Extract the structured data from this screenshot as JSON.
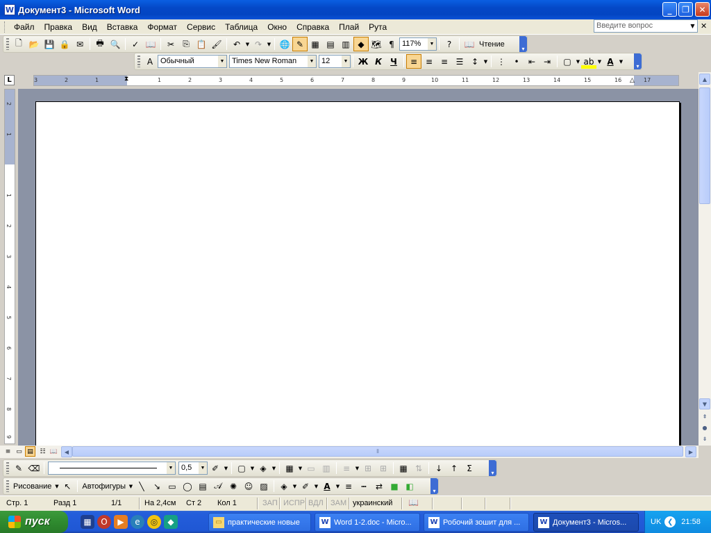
{
  "window": {
    "title": "Документ3 - Microsoft Word",
    "app_icon": "W"
  },
  "menu": {
    "items": [
      "Файл",
      "Правка",
      "Вид",
      "Вставка",
      "Формат",
      "Сервис",
      "Таблица",
      "Окно",
      "Справка",
      "Плай",
      "Рута"
    ],
    "ask_placeholder": "Введите вопрос"
  },
  "standard_toolbar": {
    "zoom": "117%",
    "read_label": "Чтение"
  },
  "formatting_toolbar": {
    "style": "Обычный",
    "font": "Times New Roman",
    "size": "12",
    "bold": "Ж",
    "italic": "К",
    "underline": "Ч"
  },
  "ruler": {
    "tab_selector": "L",
    "h_labels": [
      "3",
      "2",
      "1",
      "1",
      "2",
      "3",
      "4",
      "5",
      "6",
      "7",
      "8",
      "9",
      "10",
      "11",
      "12",
      "13",
      "14",
      "15",
      "16",
      "17"
    ],
    "v_labels": [
      "2",
      "1",
      "1",
      "2",
      "3",
      "4",
      "5",
      "6",
      "7",
      "8",
      "9"
    ]
  },
  "drawing_toolbar": {
    "drawing_label": "Рисование",
    "autoshapes_label": "Автофигуры"
  },
  "tables_toolbar": {
    "line_weight": "0,5"
  },
  "status": {
    "page": "Стр. 1",
    "section": "Разд 1",
    "pages": "1/1",
    "at": "На 2,4см",
    "line": "Ст 2",
    "col": "Кол 1",
    "rec": "ЗАП",
    "trk": "ИСПР",
    "ext": "ВДЛ",
    "ovr": "ЗАМ",
    "language": "украинский"
  },
  "taskbar": {
    "start": "пуск",
    "tasks": [
      {
        "label": "практические новые",
        "icon": "folder"
      },
      {
        "label": "Word 1-2.doc - Micro...",
        "icon": "word"
      },
      {
        "label": "Робочий зошит для ...",
        "icon": "word"
      },
      {
        "label": "Документ3 - Micros...",
        "icon": "word"
      }
    ],
    "lang": "UK",
    "clock": "21:58"
  },
  "colors": {
    "titlebar": "#0448c7",
    "taskbar": "#245edb",
    "start": "#2f8b2f",
    "tray": "#0f8be0",
    "highlight": "#f8d693"
  }
}
